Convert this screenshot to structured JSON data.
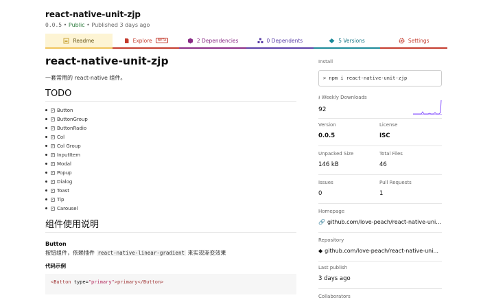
{
  "package": {
    "name": "react-native-unit-zjp",
    "version": "0.0.5",
    "visibility": "Public",
    "published": "Published 3 days ago",
    "separator": "•"
  },
  "tabs": [
    {
      "label": "Readme",
      "icon": "readme-icon",
      "color": "#6b5a1e"
    },
    {
      "label": "Explore",
      "badge": "BETA",
      "icon": "explore-icon",
      "color": "#c43b2d"
    },
    {
      "label": "2 Dependencies",
      "icon": "dependencies-icon",
      "color": "#8a2b86"
    },
    {
      "label": "0 Dependents",
      "icon": "dependents-icon",
      "color": "#5b3fa8"
    },
    {
      "label": "5 Versions",
      "icon": "versions-icon",
      "color": "#1b7a89"
    },
    {
      "label": "Settings",
      "icon": "settings-icon",
      "color": "#c43b2d"
    }
  ],
  "readme": {
    "title": "react-native-unit-zjp",
    "description": "一套常用的 react-native 组件。",
    "todo_heading": "TODO",
    "todo_items": [
      "Button",
      "ButtonGroup",
      "ButtonRadio",
      "Col",
      "Col Group",
      "InputItem",
      "Modal",
      "Popup",
      "Dialog",
      "Toast",
      "Tip",
      "Carousel"
    ],
    "usage_heading": "组件使用说明",
    "button_heading": "Button",
    "button_desc_prefix": "按钮组件，依赖插件",
    "button_desc_code": "react-native-linear-gradient",
    "button_desc_suffix": "来实现渐变效果",
    "example_heading": "代码示例",
    "code_open_tag": "<Button",
    "code_attr": " type=",
    "code_attr_value": "\"primary\"",
    "code_close": ">primary</Button>"
  },
  "sidebar": {
    "install_label": "Install",
    "install_command": "> npm i react-native-unit-zjp",
    "weekly_downloads_label": "Weekly Downloads",
    "weekly_downloads_value": "92",
    "version_label": "Version",
    "version_value": "0.0.5",
    "license_label": "License",
    "license_value": "ISC",
    "unpacked_size_label": "Unpacked Size",
    "unpacked_size_value": "146 kB",
    "total_files_label": "Total Files",
    "total_files_value": "46",
    "issues_label": "Issues",
    "issues_value": "0",
    "pull_requests_label": "Pull Requests",
    "pull_requests_value": "1",
    "homepage_label": "Homepage",
    "homepage_value": "github.com/love-peach/react-native-uni...",
    "repository_label": "Repository",
    "repository_value": "github.com/love-peach/react-native-uni...",
    "last_publish_label": "Last publish",
    "last_publish_value": "3 days ago",
    "collaborators_label": "Collaborators"
  },
  "colors": {
    "sparkline": "#8956ff",
    "readme_tab_bg": "#fdf4d4"
  }
}
